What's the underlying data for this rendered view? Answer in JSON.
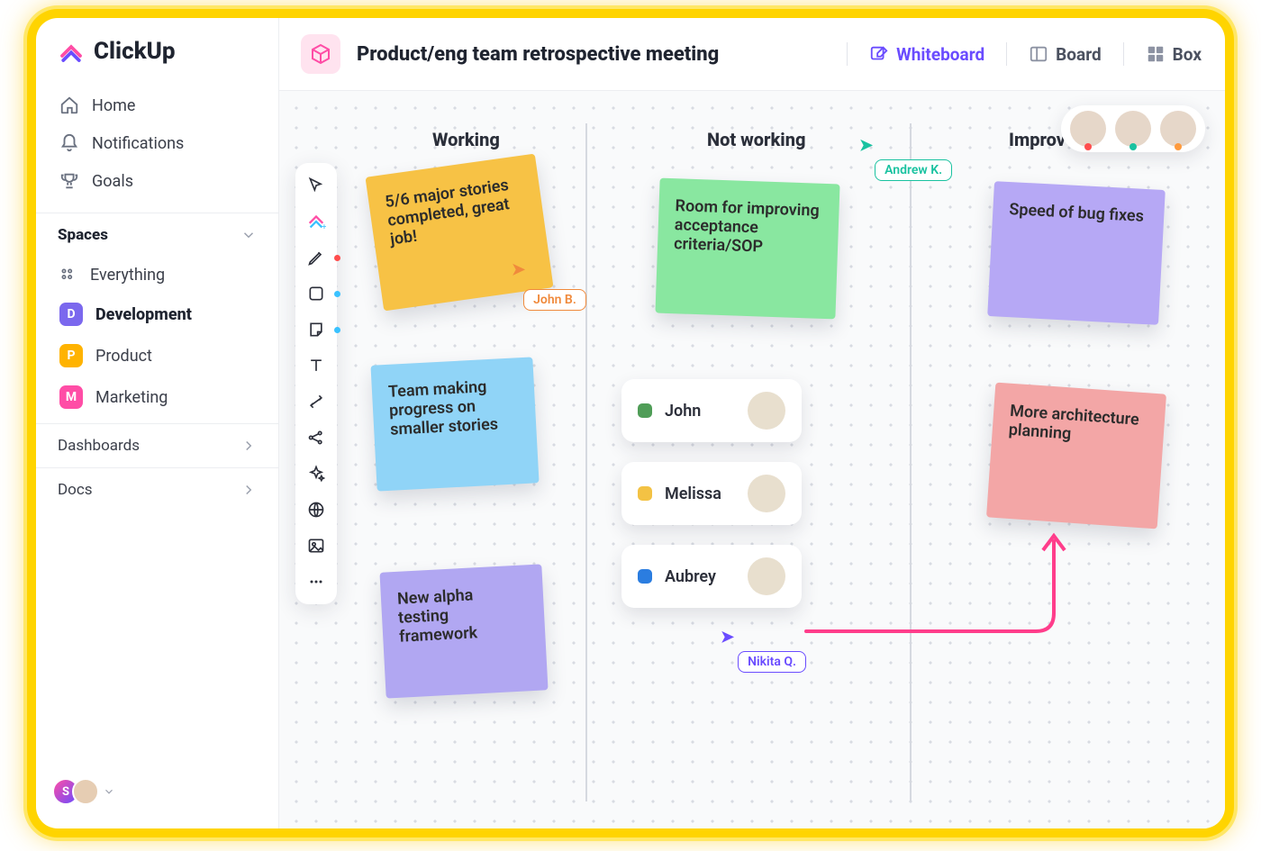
{
  "brand": "ClickUp",
  "sidebar": {
    "nav": [
      {
        "label": "Home",
        "icon": "home"
      },
      {
        "label": "Notifications",
        "icon": "bell"
      },
      {
        "label": "Goals",
        "icon": "trophy"
      }
    ],
    "spaces_header": "Spaces",
    "everything_label": "Everything",
    "spaces": [
      {
        "letter": "D",
        "label": "Development",
        "color": "#7b68ee",
        "active": true
      },
      {
        "letter": "P",
        "label": "Product",
        "color": "#ffb300",
        "active": false
      },
      {
        "letter": "M",
        "label": "Marketing",
        "color": "#ff4da6",
        "active": false
      }
    ],
    "collapsibles": [
      {
        "label": "Dashboards"
      },
      {
        "label": "Docs"
      }
    ],
    "footer_user_initial": "S"
  },
  "header": {
    "title": "Product/eng team retrospective meeting",
    "views": [
      {
        "label": "Whiteboard",
        "active": true
      },
      {
        "label": "Board",
        "active": false
      },
      {
        "label": "Box",
        "active": false
      }
    ]
  },
  "whiteboard": {
    "columns": [
      {
        "label": "Working"
      },
      {
        "label": "Not working"
      },
      {
        "label": "Improve"
      }
    ],
    "stickies": {
      "s1": {
        "text": "5/6 major stories completed, great job!",
        "color": "#f7c245"
      },
      "s2": {
        "text": "Team making progress on smaller stories",
        "color": "#90d4f7"
      },
      "s3": {
        "text": "New alpha testing framework",
        "color": "#b1a7f2"
      },
      "s4": {
        "text": "Room for improving acceptance criteria/SOP",
        "color": "#89e7a0"
      },
      "s5": {
        "text": "Speed of bug fixes",
        "color": "#b6a8f5"
      },
      "s6": {
        "text": "More architecture planning",
        "color": "#f3a6a6"
      }
    },
    "people_cards": [
      {
        "name": "John",
        "color": "#4f9d57"
      },
      {
        "name": "Melissa",
        "color": "#f3c244"
      },
      {
        "name": "Aubrey",
        "color": "#2b7de0"
      }
    ],
    "cursors": {
      "john": {
        "label": "John B.",
        "color": "#f08a3c"
      },
      "andrew": {
        "label": "Andrew K.",
        "color": "#19c2a0"
      },
      "nikita": {
        "label": "Nikita Q.",
        "color": "#6a4cff"
      }
    },
    "presence_dots": [
      "#ff4d4d",
      "#19c2a0",
      "#ff9a3c"
    ],
    "toolbar_icons": [
      "cursor",
      "clickup-plus",
      "pen",
      "square",
      "note",
      "text",
      "connector",
      "share",
      "sparkle",
      "globe",
      "image",
      "more"
    ],
    "tool_dots": {
      "pen": "#ff4d4d",
      "square": "#3ac2ff",
      "note": "#3ac2ff"
    }
  }
}
